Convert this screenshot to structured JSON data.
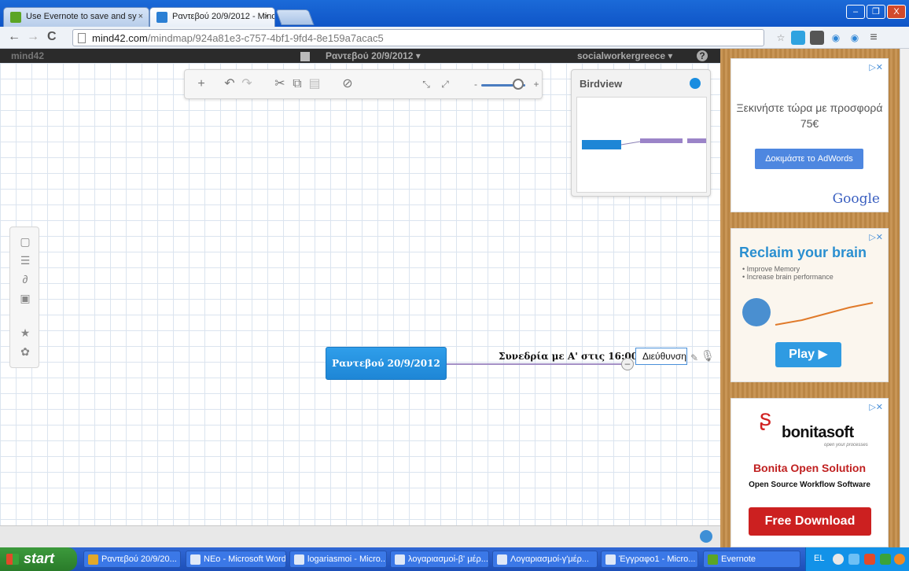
{
  "browser": {
    "tabs": [
      {
        "label": "Use Evernote to save and sy",
        "close": "×"
      },
      {
        "label": "Ραντεβού 20/9/2012 - Mind4",
        "close": "×"
      }
    ],
    "url_domain": "mind42.com",
    "url_path": "/mindmap/924a81e3-c757-4bf1-9fd4-8e159a7acac5",
    "window_buttons": [
      "–",
      "❐",
      "X"
    ]
  },
  "app": {
    "logo": "mind42",
    "map_title": "Ραντεβού 20/9/2012 ▾",
    "user": "socialworkergreece ▾",
    "help": "?"
  },
  "toolbar": {
    "zoom_minus": "-",
    "zoom_plus": "+",
    "zoom_level": 0.65
  },
  "birdview": {
    "title": "Birdview"
  },
  "mindmap": {
    "root_node": "Ραντεβού 20/9/2012",
    "child_node": "Συνεδρία με Α' στις 16:00",
    "editing_value": "Διεύθυνση",
    "collapse_glyph": "–"
  },
  "ads": {
    "ad1": {
      "text": "Ξεκινήστε τώρα με προσφορά 75€",
      "button": "Δοκιμάστε το AdWords",
      "brand": "Google"
    },
    "ad2": {
      "title": "Reclaim your brain",
      "bullets": [
        "• Improve Memory",
        "• Increase brain performance"
      ],
      "button": "Play ▶"
    },
    "ad3": {
      "brand": "bonitasoft",
      "tagline": "open your processes",
      "title": "Bonita Open Solution",
      "desc": "Open Source Workflow Software",
      "button": "Free Download"
    },
    "close": "▷✕"
  },
  "taskbar": {
    "start": "start",
    "items": [
      "Ραντεβού 20/9/20...",
      "NEo - Microsoft Word",
      "logariasmoi - Micro...",
      "λογαριασμοί-β' μέρ...",
      "Λογαριασμοί-γ'μέρ...",
      "Έγγραφο1 - Micro...",
      "Evernote"
    ],
    "lang": "EL"
  },
  "colors": {
    "root_node": "#1e86d6",
    "connector": "#a48fc6",
    "ad_panel": "#c48d49",
    "free_download": "#cc2020"
  }
}
